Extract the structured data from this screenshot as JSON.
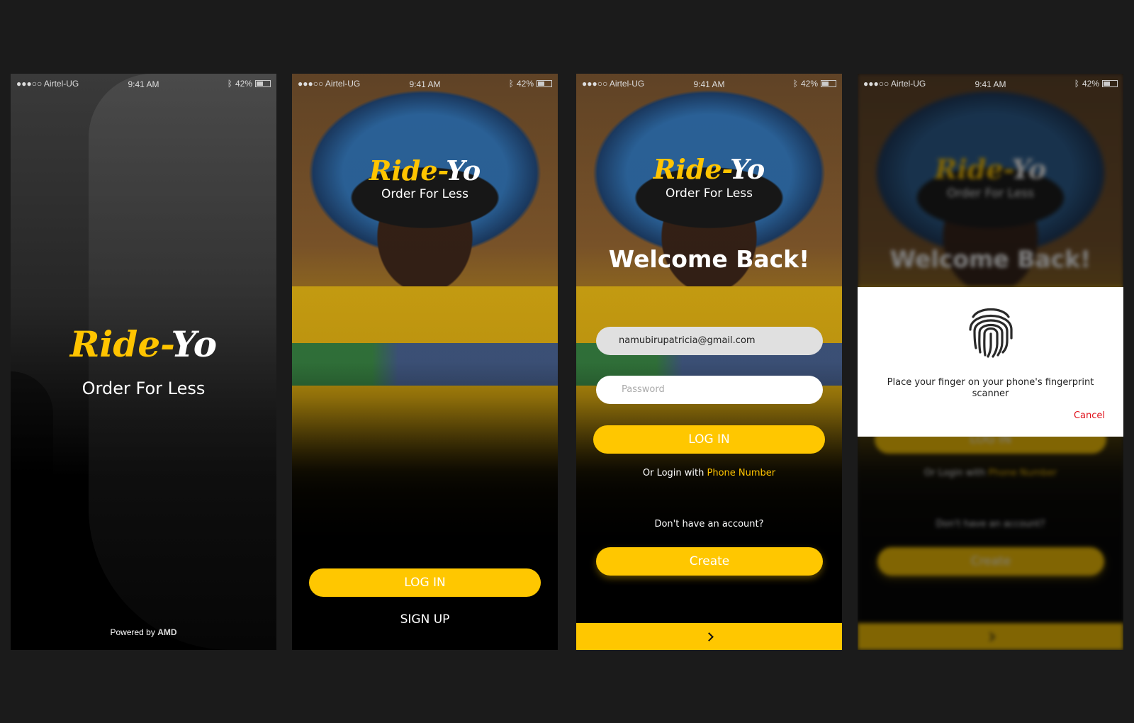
{
  "status": {
    "carrier": "●●●○○ Airtel-UG",
    "time": "9:41 AM",
    "battery": "42%"
  },
  "brand": {
    "name_part1": "Ride-",
    "name_part2": "Yo",
    "tagline": "Order For Less",
    "accent_color": "#ffc700"
  },
  "splash": {
    "powered_by": "Powered by",
    "powered_brand": "AMD"
  },
  "landing": {
    "login_label": "LOG IN",
    "signup_label": "SIGN UP"
  },
  "login": {
    "welcome": "Welcome Back!",
    "email_value": "namubirupatricia@gmail.com",
    "password_placeholder": "Password",
    "login_label": "LOG IN",
    "alt_prefix": "Or Login with",
    "alt_link": "Phone Number",
    "no_account": "Don't have an account?",
    "create_label": "Create"
  },
  "fingerprint_modal": {
    "message": "Place your finger on your phone's fingerprint scanner",
    "cancel_label": "Cancel",
    "icon": "fingerprint-icon"
  }
}
